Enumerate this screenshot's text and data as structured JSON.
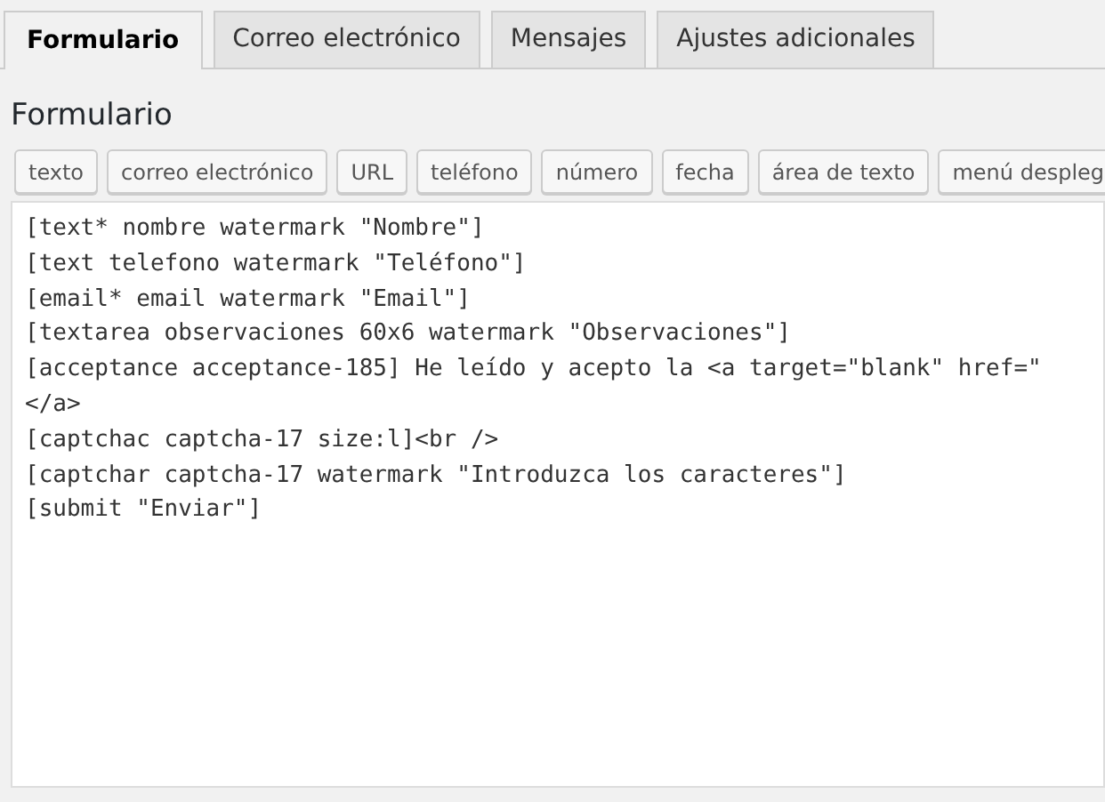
{
  "tabs": [
    {
      "label": "Formulario",
      "selected": true
    },
    {
      "label": "Correo electrónico",
      "selected": false
    },
    {
      "label": "Mensajes",
      "selected": false
    },
    {
      "label": "Ajustes adicionales",
      "selected": false
    }
  ],
  "section_title": "Formulario",
  "tag_buttons": [
    "texto",
    "correo electrónico",
    "URL",
    "teléfono",
    "número",
    "fecha",
    "área de texto",
    "menú despleg"
  ],
  "editor": {
    "lines": [
      "[text* nombre watermark \"Nombre\"]",
      "[text telefono watermark \"Teléfono\"]",
      "[email* email watermark \"Email\"]",
      "[textarea observaciones 60x6 watermark \"Observaciones\"]",
      "[acceptance acceptance-185] He leído y acepto la <a target=\"blank\" href=\"",
      "</a>",
      "[captchac captcha-17 size:l]<br />",
      "[captchar captcha-17 watermark \"Introduzca los caracteres\"]",
      "[submit \"Enviar\"]"
    ]
  }
}
